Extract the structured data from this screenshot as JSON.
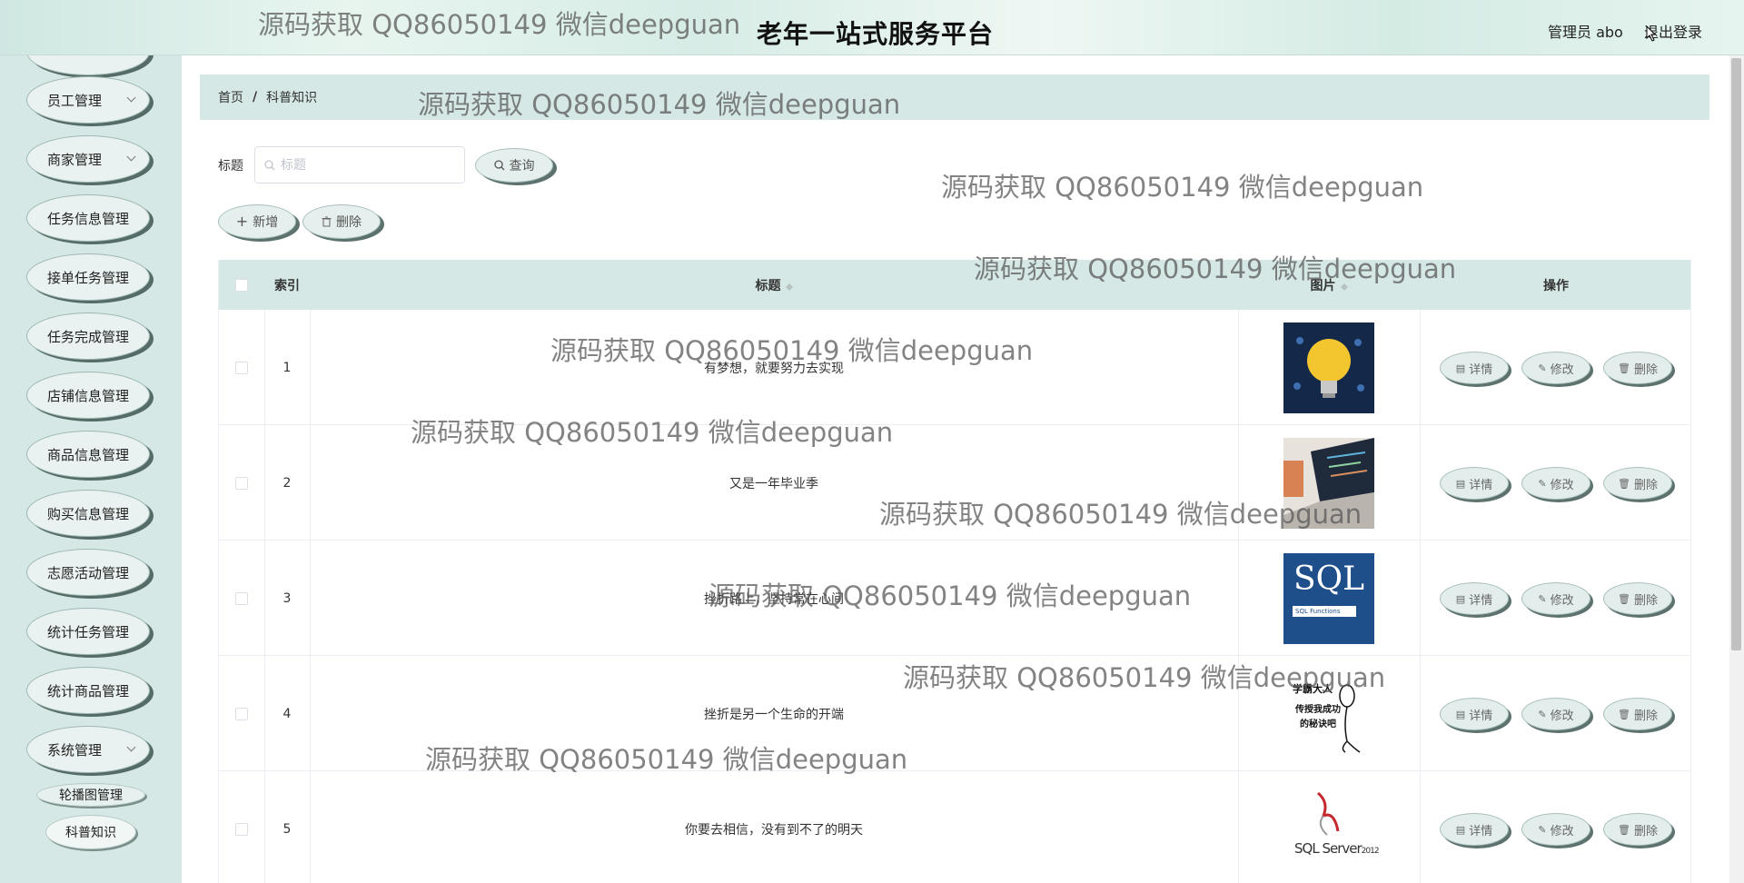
{
  "header": {
    "title": "老年一站式服务平台",
    "user": "管理员 abo",
    "logout": "退出登录"
  },
  "sidebar": {
    "items": [
      {
        "label": "员工管理",
        "has_sub": true
      },
      {
        "label": "商家管理",
        "has_sub": true
      },
      {
        "label": "任务信息管理",
        "has_sub": false
      },
      {
        "label": "接单任务管理",
        "has_sub": false
      },
      {
        "label": "任务完成管理",
        "has_sub": false
      },
      {
        "label": "店铺信息管理",
        "has_sub": false
      },
      {
        "label": "商品信息管理",
        "has_sub": false
      },
      {
        "label": "购买信息管理",
        "has_sub": false
      },
      {
        "label": "志愿活动管理",
        "has_sub": false
      },
      {
        "label": "统计任务管理",
        "has_sub": false
      },
      {
        "label": "统计商品管理",
        "has_sub": false
      },
      {
        "label": "系统管理",
        "has_sub": true
      }
    ],
    "sub_items": [
      {
        "label": "轮播图管理",
        "active": false
      },
      {
        "label": "科普知识",
        "active": true
      }
    ]
  },
  "breadcrumb": {
    "home": "首页",
    "separator": "/",
    "current": "科普知识"
  },
  "search": {
    "label": "标题",
    "placeholder": "标题",
    "value": "",
    "query_button": "查询"
  },
  "actions": {
    "add": "新增",
    "delete": "删除"
  },
  "table": {
    "columns": {
      "index": "索引",
      "title": "标题",
      "image": "图片",
      "ops": "操作"
    },
    "rows": [
      {
        "index": "1",
        "title": "有梦想，就要努力去实现",
        "image": "lightbulb-image"
      },
      {
        "index": "2",
        "title": "又是一年毕业季",
        "image": "laptop-image"
      },
      {
        "index": "3",
        "title": "挫折路上，坚持常在心间",
        "image": "sql-image",
        "image_text": "SQL",
        "image_subtext": "SQL Functions"
      },
      {
        "index": "4",
        "title": "挫折是另一个生命的开端",
        "image": "comic-image",
        "image_text": "学霸大人",
        "image_subtext": "传授我成功的秘诀吧"
      },
      {
        "index": "5",
        "title": "你要去相信，没有到不了的明天",
        "image": "sqlserver-image",
        "image_text": "SQL Server",
        "image_subtext": "2012"
      }
    ],
    "row_actions": {
      "detail": "详情",
      "edit": "修改",
      "delete": "删除"
    }
  },
  "watermark": "源码获取 QQ86050149 微信deepguan",
  "colors": {
    "panel": "#d5e8e5",
    "button_shadow": "#5d716e"
  }
}
